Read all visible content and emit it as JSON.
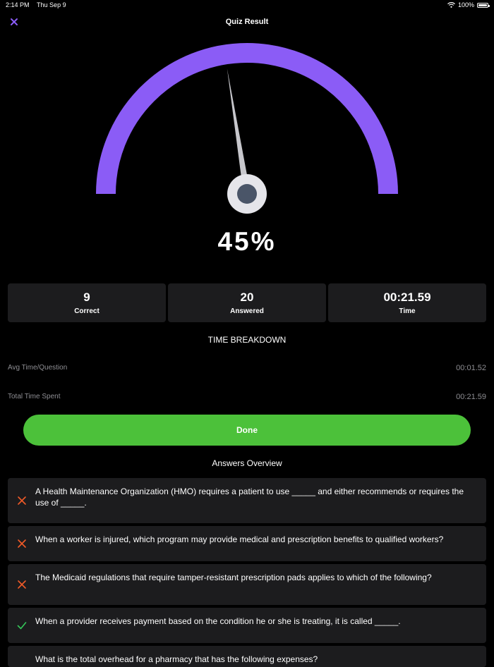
{
  "status_bar": {
    "time": "2:14 PM",
    "date": "Thu Sep 9",
    "battery": "100%"
  },
  "nav": {
    "title": "Quiz Result",
    "close_icon": "close-icon",
    "accent_color": "#8b5cf6"
  },
  "gauge": {
    "percent_value": 45,
    "percent_text": "45%",
    "arc_color": "#8b5cf6",
    "needle_color": "#c7c7cc"
  },
  "stats": [
    {
      "value": "9",
      "label": "Correct"
    },
    {
      "value": "20",
      "label": "Answered"
    },
    {
      "value": "00:21.59",
      "label": "Time"
    }
  ],
  "time_breakdown": {
    "title": "TIME BREAKDOWN",
    "rows": [
      {
        "label": "Avg Time/Question",
        "value": "00:01.52"
      },
      {
        "label": "Total Time Spent",
        "value": "00:21.59"
      }
    ]
  },
  "done_button": {
    "label": "Done",
    "color": "#4cc13a"
  },
  "answers_overview": {
    "title": "Answers Overview",
    "items": [
      {
        "status": "incorrect",
        "icon": "x-mark-icon",
        "text": "A Health Maintenance Organization (HMO) requires a patient to use _____ and either recommends or requires the use of _____."
      },
      {
        "status": "incorrect",
        "icon": "x-mark-icon",
        "text": "When a worker is injured, which program may provide medical and prescription benefits to qualified workers?"
      },
      {
        "status": "incorrect",
        "icon": "x-mark-icon",
        "text": "The Medicaid regulations that require tamper-resistant prescription pads applies to which of the following?"
      },
      {
        "status": "correct",
        "icon": "checkmark-icon",
        "text": "When a provider receives payment based on the condition he or she is treating, it is called _____."
      },
      {
        "status": "unknown",
        "icon": "",
        "text": "What is the total overhead for a pharmacy that has the following expenses?"
      }
    ],
    "incorrect_color": "#f05a28",
    "correct_color": "#34c759"
  }
}
